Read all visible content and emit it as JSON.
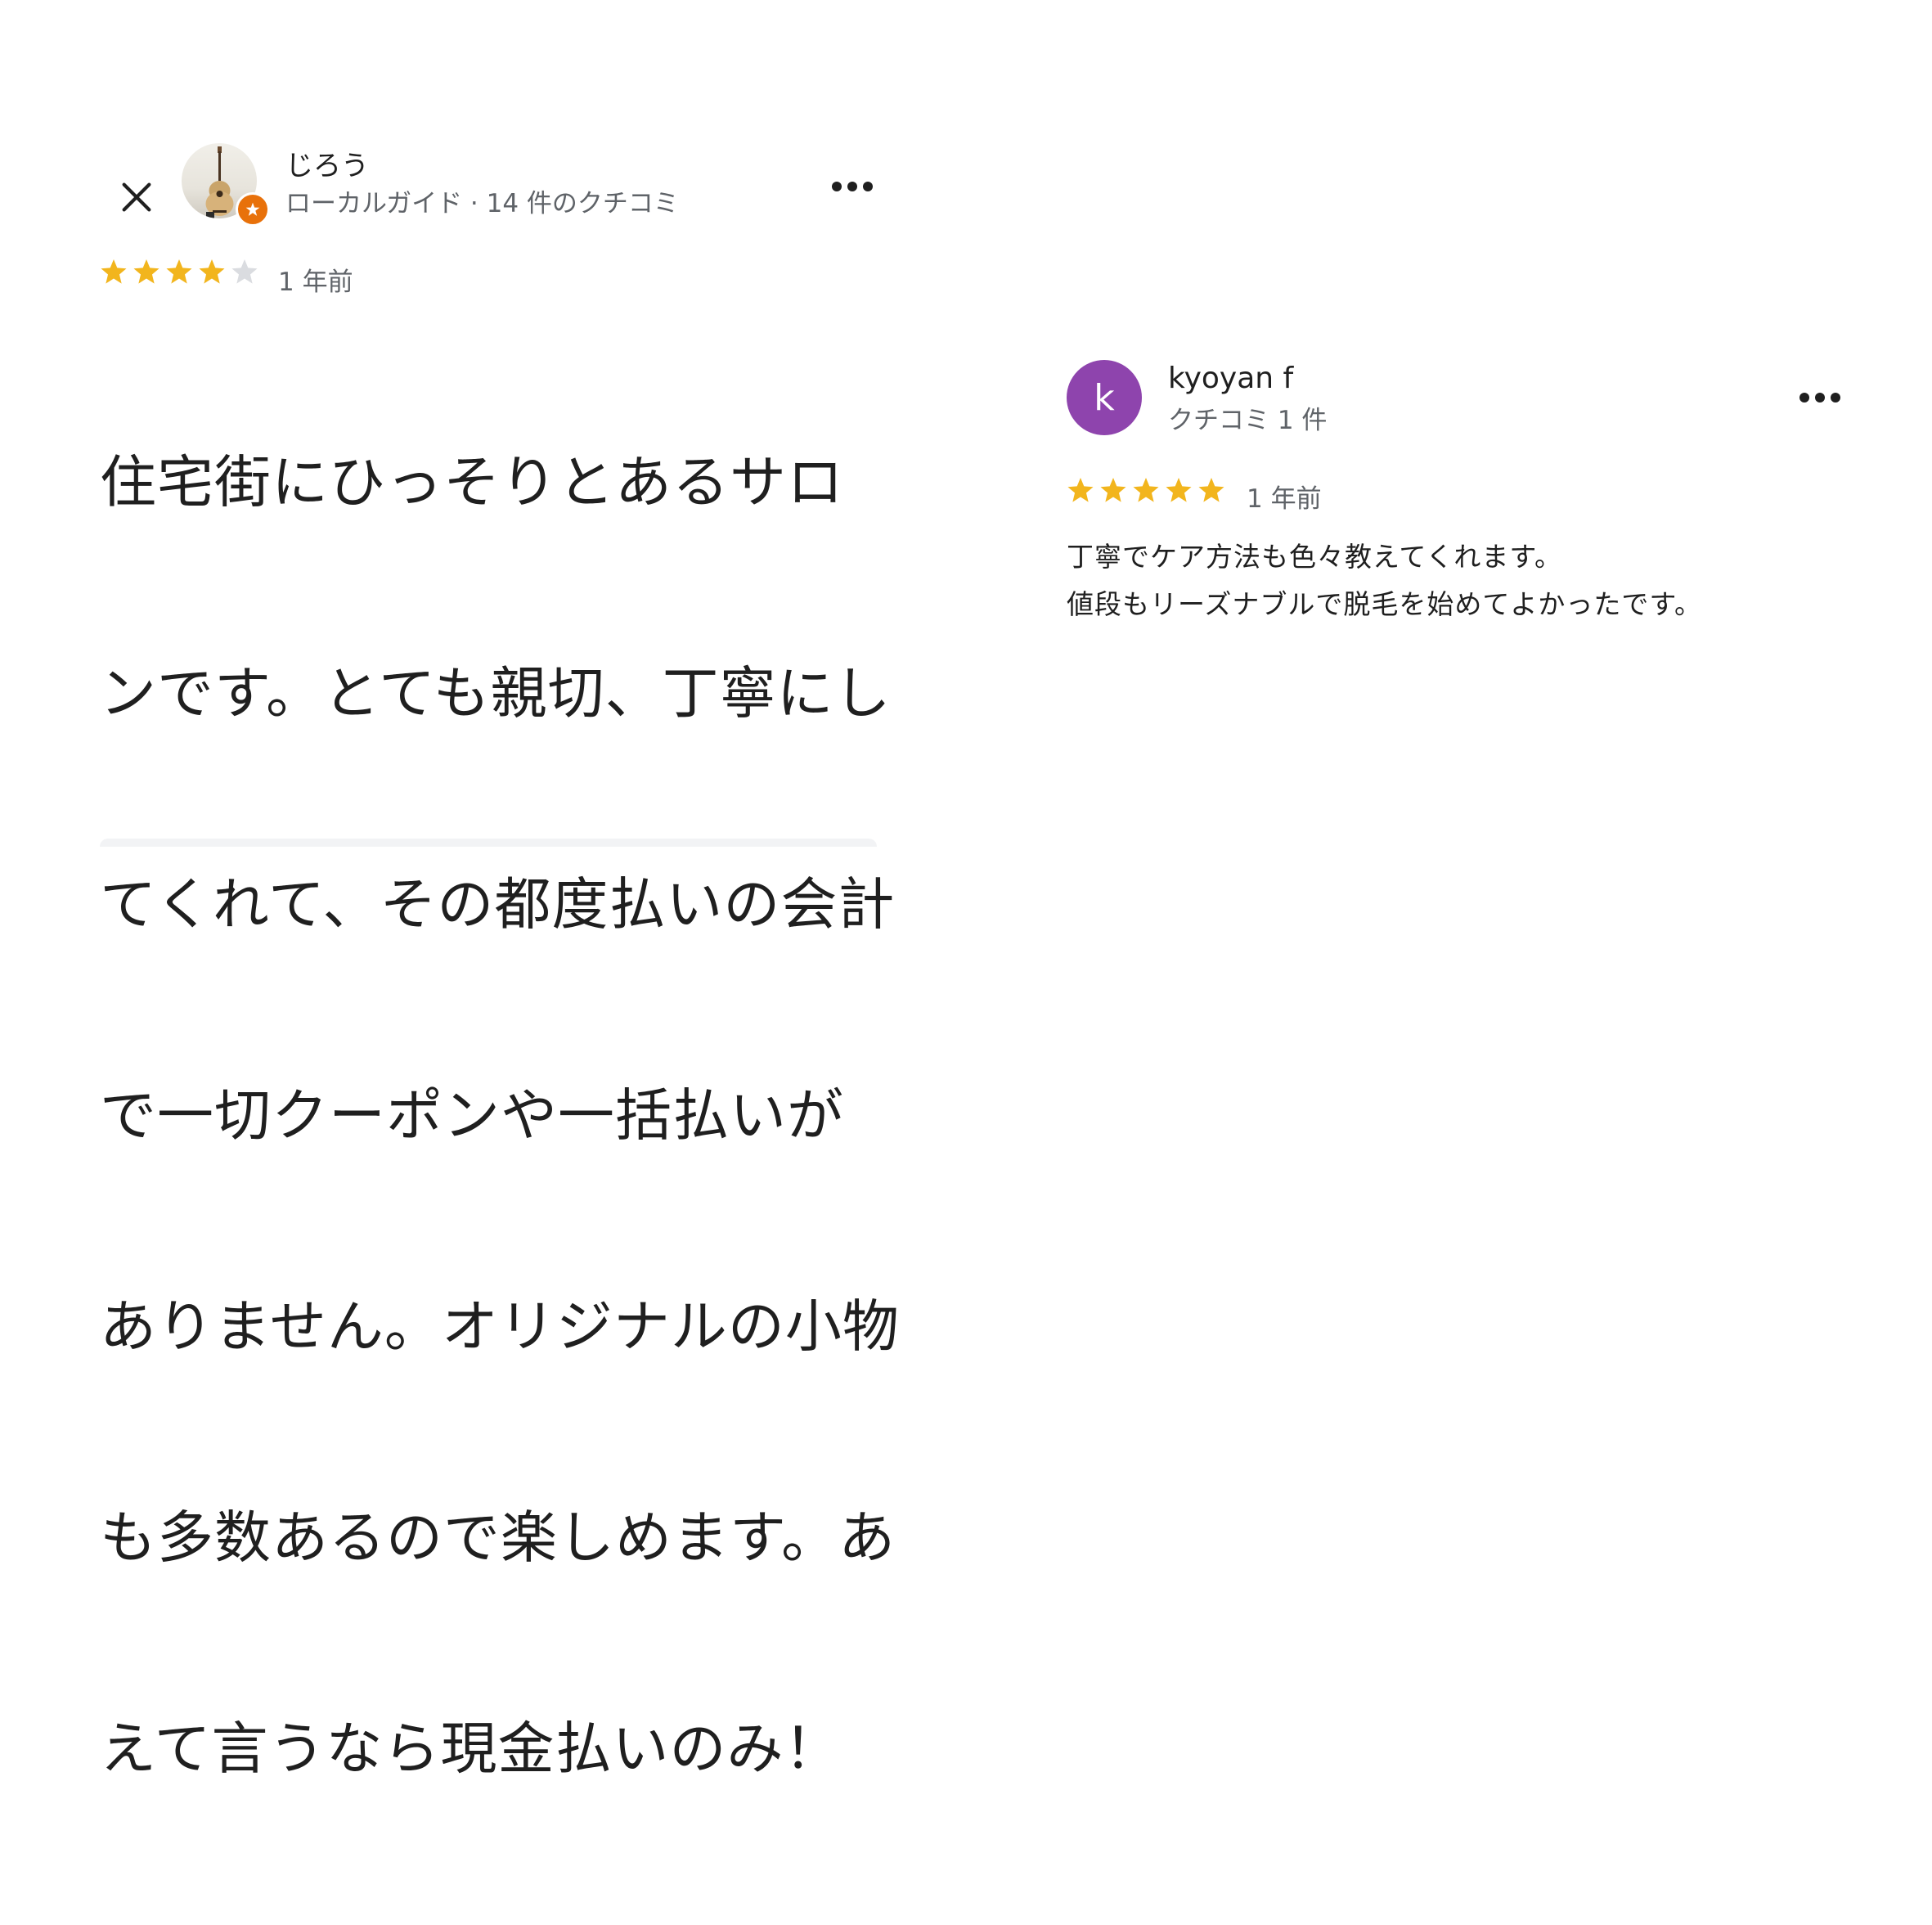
{
  "colors": {
    "star_filled": "#f2b51d",
    "star_empty": "#dadce0",
    "guide_badge": "#e8710a",
    "avatar_letter_bg": "#8e44ad",
    "meta_text": "#5f6368"
  },
  "review_left": {
    "close_icon": "close-icon",
    "avatar_icon": "guitar-photo-avatar",
    "badge_icon": "local-guide-star-icon",
    "reviewer_name": "じろう",
    "reviewer_meta": "ローカルガイド · 14 件のクチコミ",
    "more_icon": "more-horiz-icon",
    "rating": 4,
    "rating_max": 5,
    "date": "1 年前",
    "text": "住宅街にひっそりとあるサロンです。とても親切、丁寧にしてくれて、その都度払いの会計で一切クーポンや一括払いがありません。オリジナルの小物も多数あるので楽しめます。あえて言うなら現金払いのみ！",
    "text_lines": [
      "住宅街にひっそりとあるサロ",
      "ンです。とても親切、丁寧にし",
      "てくれて、その都度払いの会計",
      "で一切クーポンや一括払いが",
      "ありません。オリジナルの小物",
      "も多数あるので楽しめます。あ",
      "えて言うなら現金払いのみ！"
    ]
  },
  "review_right": {
    "avatar_letter": "k",
    "reviewer_name": "kyoyan f",
    "reviewer_meta": "クチコミ 1 件",
    "more_icon": "more-horiz-icon",
    "rating": 5,
    "rating_max": 5,
    "date": "1 年前",
    "text_lines": [
      "丁寧でケア方法も色々教えてくれます。",
      "値段もリーズナブルで脱毛を始めてよかったです。"
    ]
  }
}
